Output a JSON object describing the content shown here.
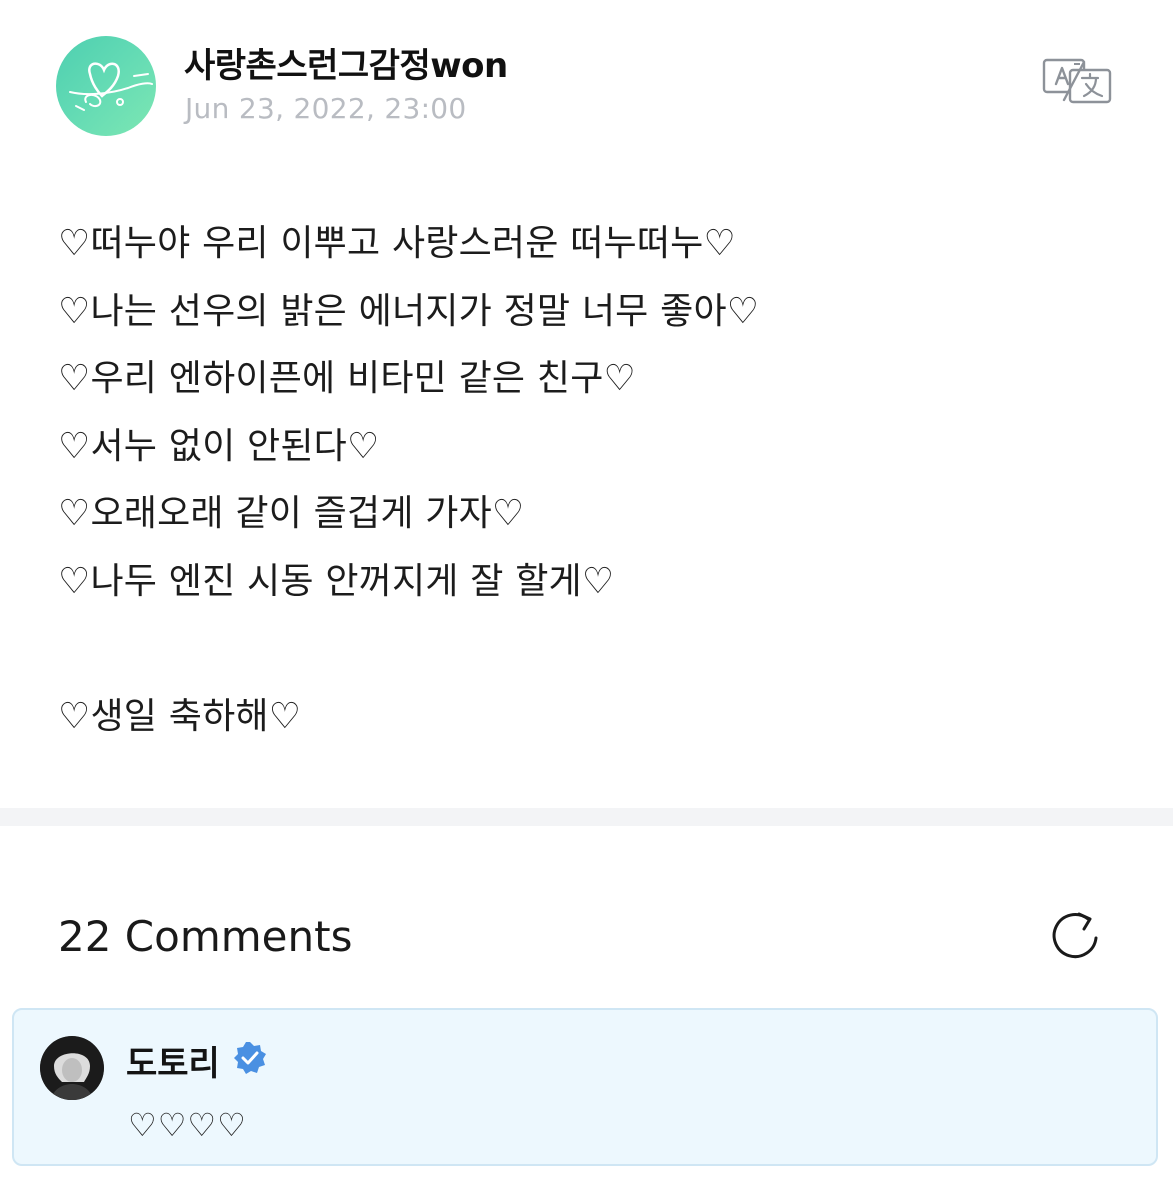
{
  "post": {
    "author": "사랑촌스런그감정won",
    "date": "Jun 23, 2022, 23:00",
    "lines": [
      "♡떠누야 우리 이뿌고 사랑스러운 떠누떠누♡",
      "♡나는 선우의 밝은 에너지가 정말 너무 좋아♡",
      "♡우리 엔하이픈에 비타민 같은 친구♡",
      "♡서누 없이 안된다♡",
      "♡오래오래 같이 즐겁게 가자♡",
      "♡나두 엔진 시동 안꺼지게 잘 할게♡",
      "♡생일 축하해♡"
    ]
  },
  "comments": {
    "count_label": "22 Comments",
    "items": [
      {
        "author": "도토리",
        "verified": true,
        "text": "♡♡♡♡"
      }
    ]
  },
  "icons": {
    "translate": "translate-icon",
    "refresh": "refresh-icon",
    "verified": "verified-badge-icon"
  },
  "colors": {
    "avatar_gradient_start": "#4ecfb0",
    "avatar_gradient_end": "#7de7b3",
    "date_gray": "#b9bcc2",
    "divider": "#f3f4f6",
    "comment_bg": "#edf8fe",
    "comment_border": "#cfe6f4",
    "verified_blue": "#4a90e2"
  }
}
